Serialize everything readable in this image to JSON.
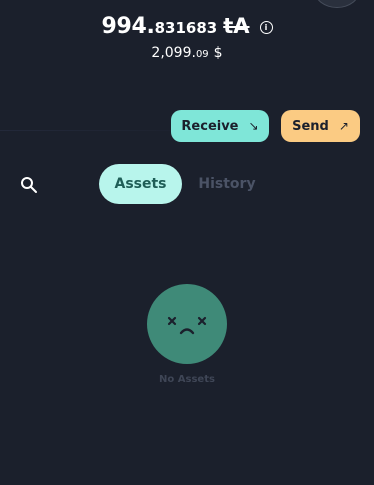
{
  "balance": {
    "integer": "994.",
    "decimal": "831683",
    "currency": "tA"
  },
  "fiat": {
    "integer": "2,099.",
    "decimal": "09",
    "symbol": "$"
  },
  "actions": {
    "receive_label": "Receive",
    "receive_icon": "arrow-down-right",
    "send_label": "Send",
    "send_icon": "arrow-up-right"
  },
  "tabs": [
    {
      "label": "Assets",
      "active": true
    },
    {
      "label": "History",
      "active": false
    }
  ],
  "empty_state": {
    "label": "No Assets",
    "icon": "sad-face-icon"
  },
  "colors": {
    "background": "#1b202c",
    "receive": "#7fe6d8",
    "send": "#fbcb83",
    "active_tab": "#b8f5ec",
    "face": "#3f8a78"
  }
}
